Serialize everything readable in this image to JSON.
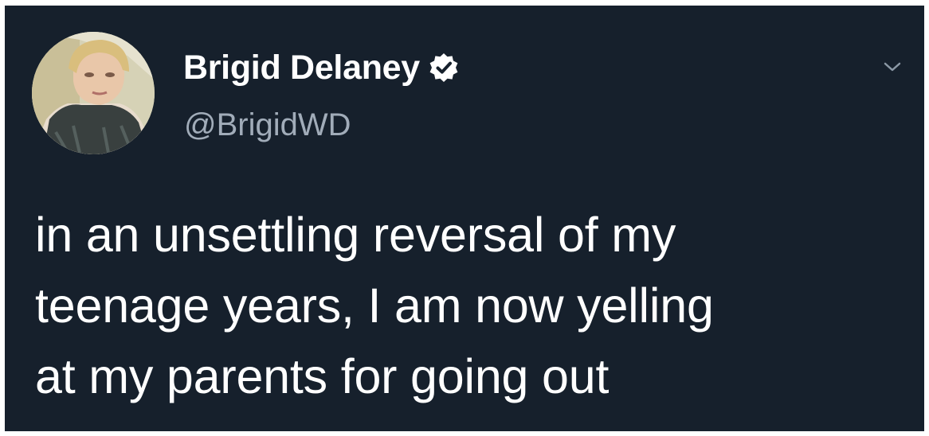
{
  "tweet": {
    "author": {
      "display_name": "Brigid Delaney",
      "handle": "@BrigidWD",
      "verified": true,
      "avatar_icon": "avatar-photo"
    },
    "more_icon": "chevron-down-icon",
    "text_lines": [
      "in an unsettling reversal of my",
      "teenage years, I am now yelling",
      "at my parents for going out"
    ]
  },
  "colors": {
    "background": "#16202c",
    "primary_text": "#ffffff",
    "secondary_text": "#a1acb9"
  }
}
